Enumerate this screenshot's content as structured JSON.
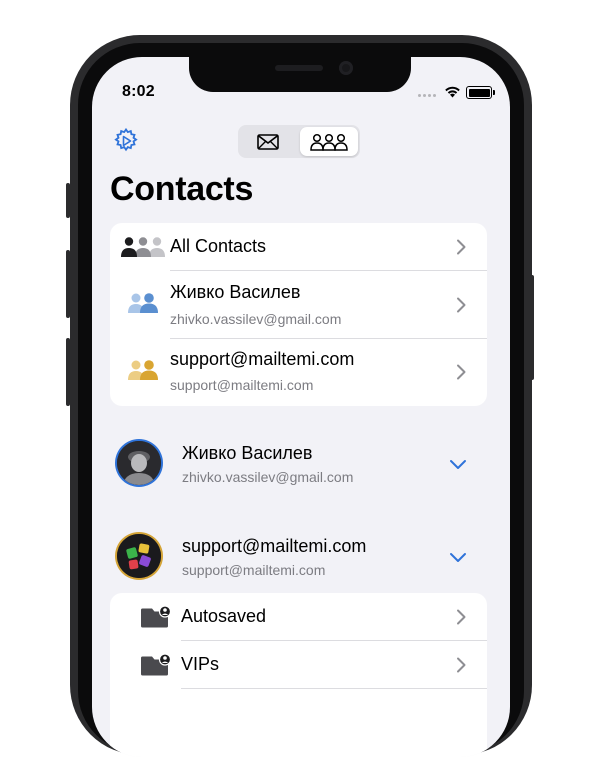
{
  "status_bar": {
    "time": "8:02"
  },
  "header": {
    "title": "Contacts"
  },
  "segments": [
    {
      "icon": "envelope-icon",
      "selected": false
    },
    {
      "icon": "people-group-icon",
      "selected": true
    }
  ],
  "contact_list": {
    "all_label": "All Contacts",
    "items": [
      {
        "name": "Живко Василев",
        "email": "zhivko.vassilev@gmail.com",
        "icon_color": "#5a8fd0"
      },
      {
        "name": "support@mailtemi.com",
        "email": "support@mailtemi.com",
        "icon_color": "#d9a531"
      }
    ]
  },
  "accounts": [
    {
      "name": "Живко Василев",
      "email": "zhivko.vassilev@gmail.com",
      "ring_color": "#2f73d9",
      "expanded": false
    },
    {
      "name": "support@mailtemi.com",
      "email": "support@mailtemi.com",
      "ring_color": "#d4a437",
      "expanded": true
    }
  ],
  "folders": [
    {
      "label": "Autosaved",
      "icon": "folder-person-icon"
    },
    {
      "label": "VIPs",
      "icon": "folder-person-icon"
    }
  ],
  "colors": {
    "accent": "#2f73d9",
    "background": "#f2f2f7"
  }
}
